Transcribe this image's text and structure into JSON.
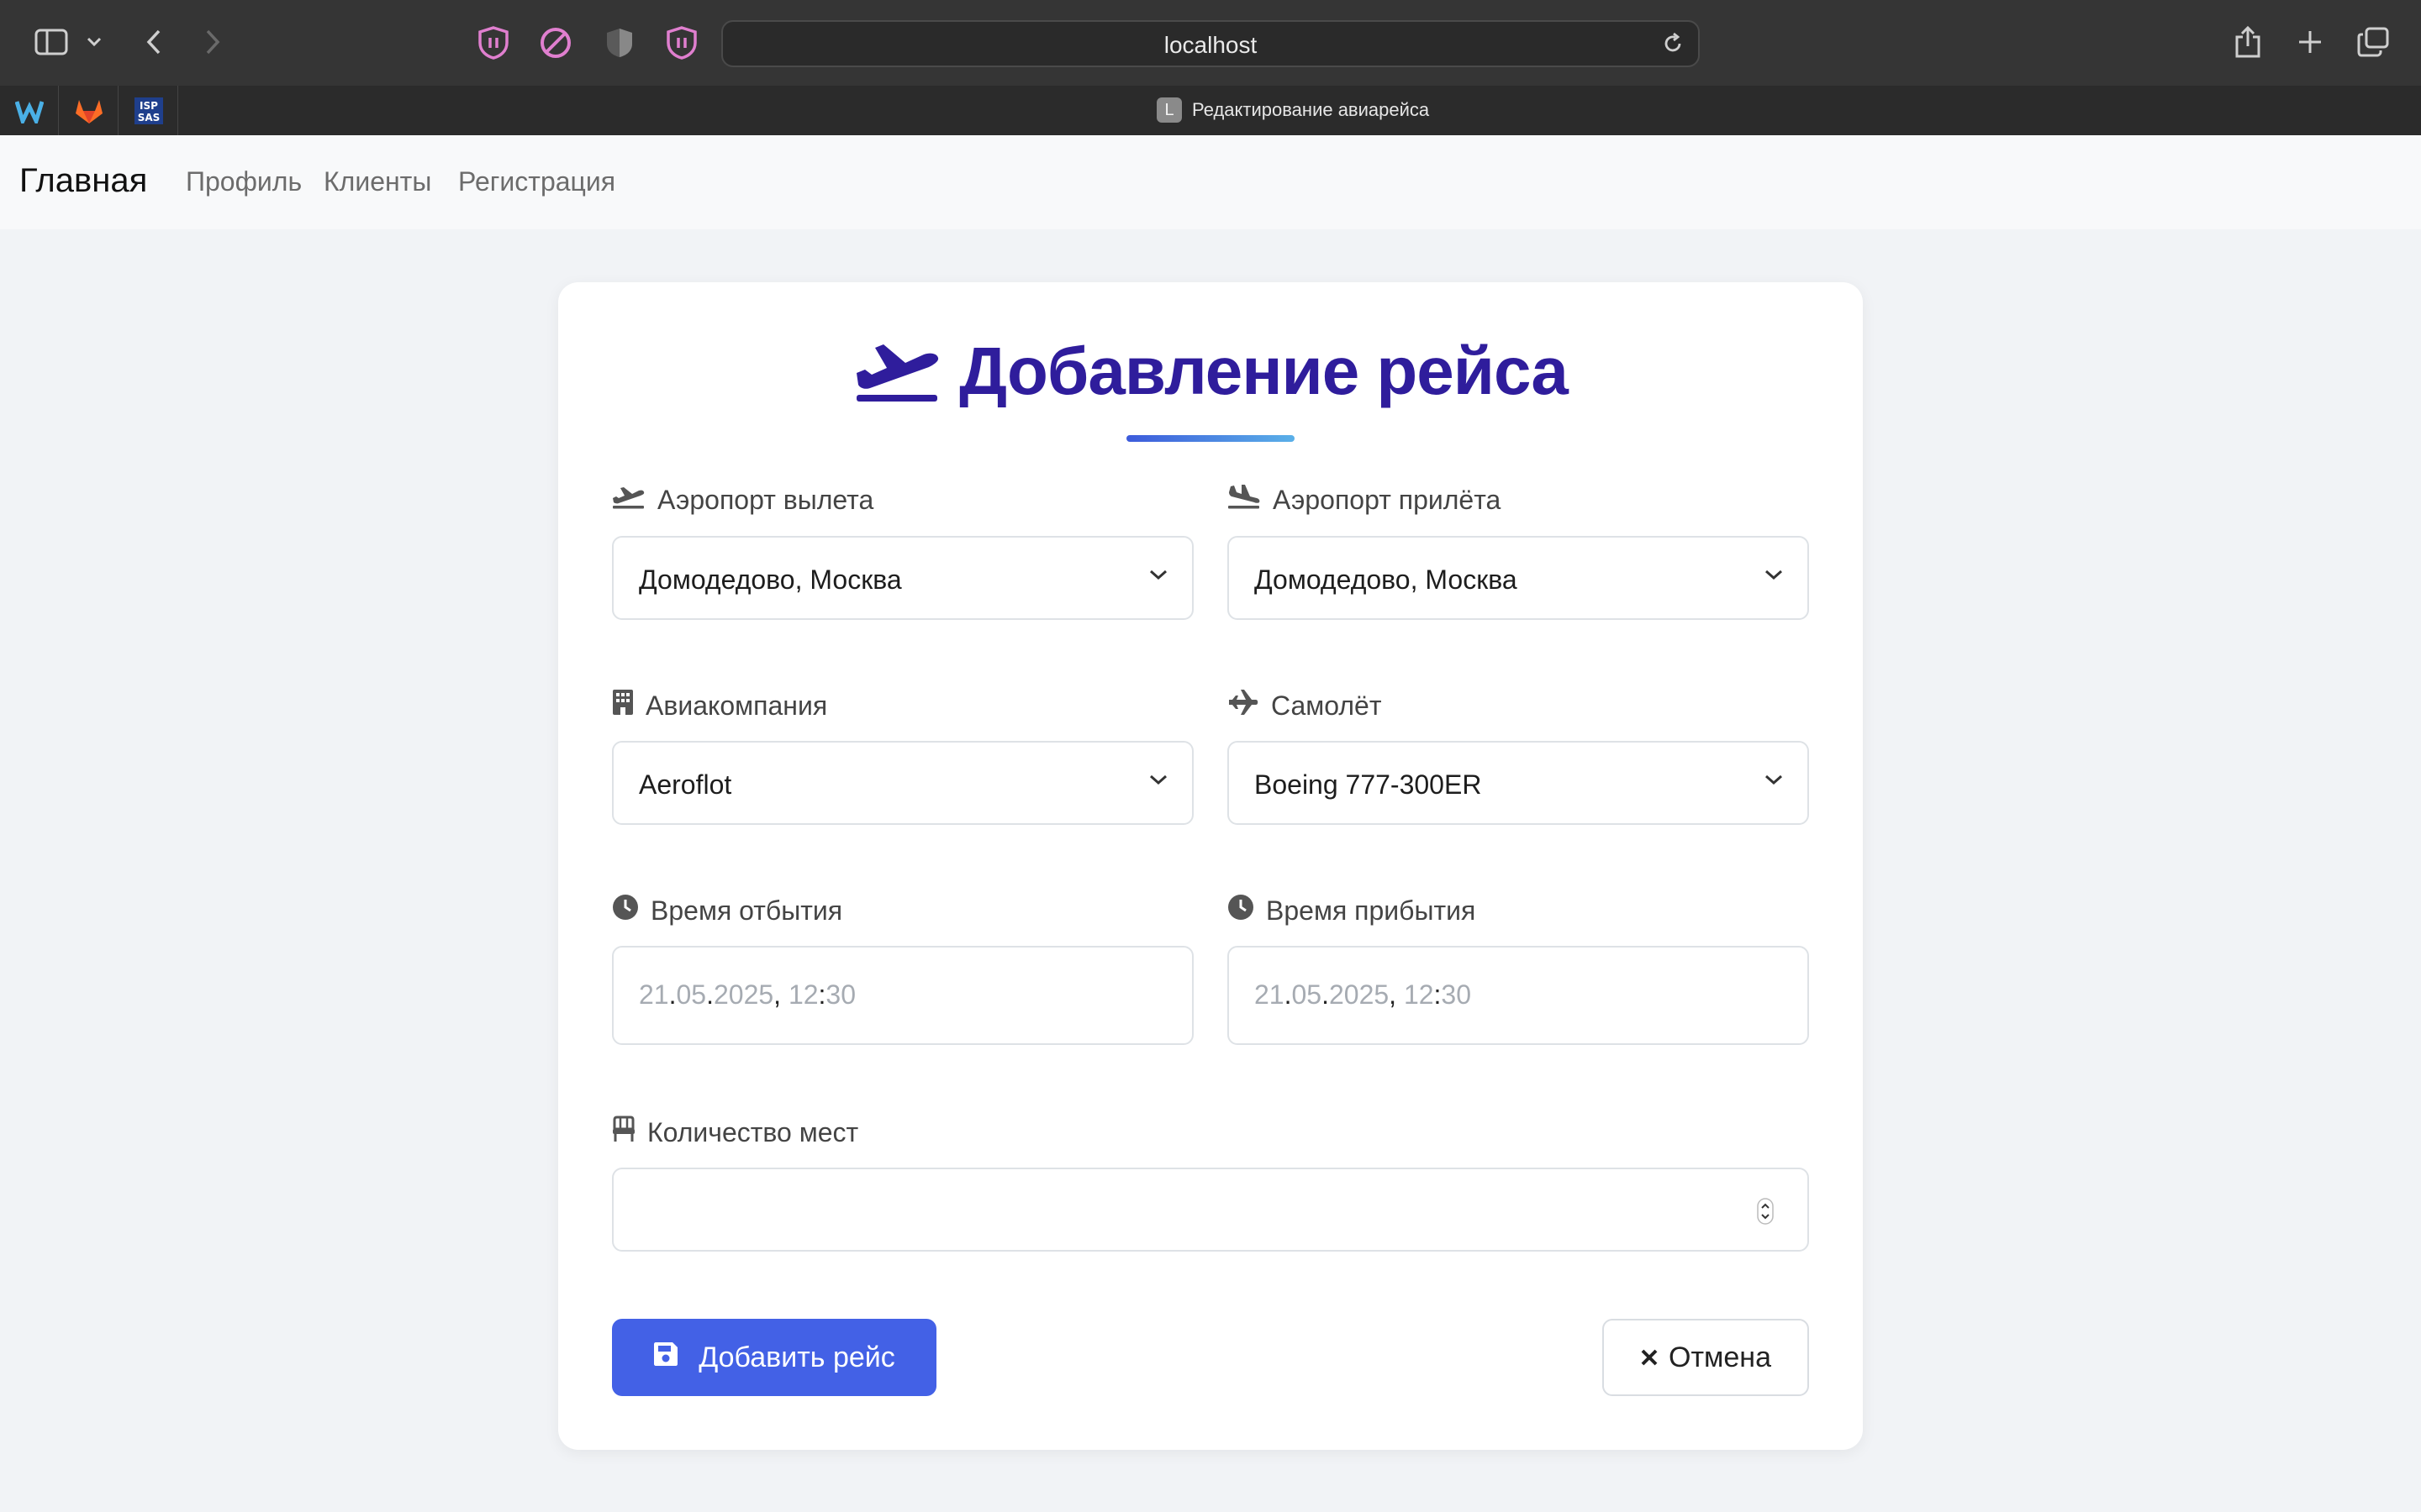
{
  "browser": {
    "url": "localhost",
    "tab_title": "Редактирование авиарейса",
    "tab_favicon_letter": "L",
    "pinned_tabs": [
      "W",
      "GL",
      "ISP SAS"
    ]
  },
  "navbar": {
    "brand": "Главная",
    "links": [
      "Профиль",
      "Клиенты",
      "Регистрация"
    ]
  },
  "form": {
    "title": "Добавление рейса",
    "departure_airport": {
      "label": "Аэропорт вылета",
      "value": "Домодедово, Москва"
    },
    "arrival_airport": {
      "label": "Аэропорт прилёта",
      "value": "Домодедово, Москва"
    },
    "airline": {
      "label": "Авиакомпания",
      "value": "Aeroflot"
    },
    "aircraft": {
      "label": "Самолёт",
      "value": "Boeing 777-300ER"
    },
    "departure_time": {
      "label": "Время отбытия",
      "day": "21",
      "month": "05",
      "year": "2025",
      "hour": "12",
      "minute": "30"
    },
    "arrival_time": {
      "label": "Время прибытия",
      "day": "21",
      "month": "05",
      "year": "2025",
      "hour": "12",
      "minute": "30"
    },
    "seats": {
      "label": "Количество мест",
      "value": ""
    },
    "submit_label": "Добавить рейс",
    "cancel_label": "Отмена"
  },
  "colors": {
    "title": "#2f1d9c",
    "primary_button": "#4361e6",
    "chrome": "#353535"
  }
}
